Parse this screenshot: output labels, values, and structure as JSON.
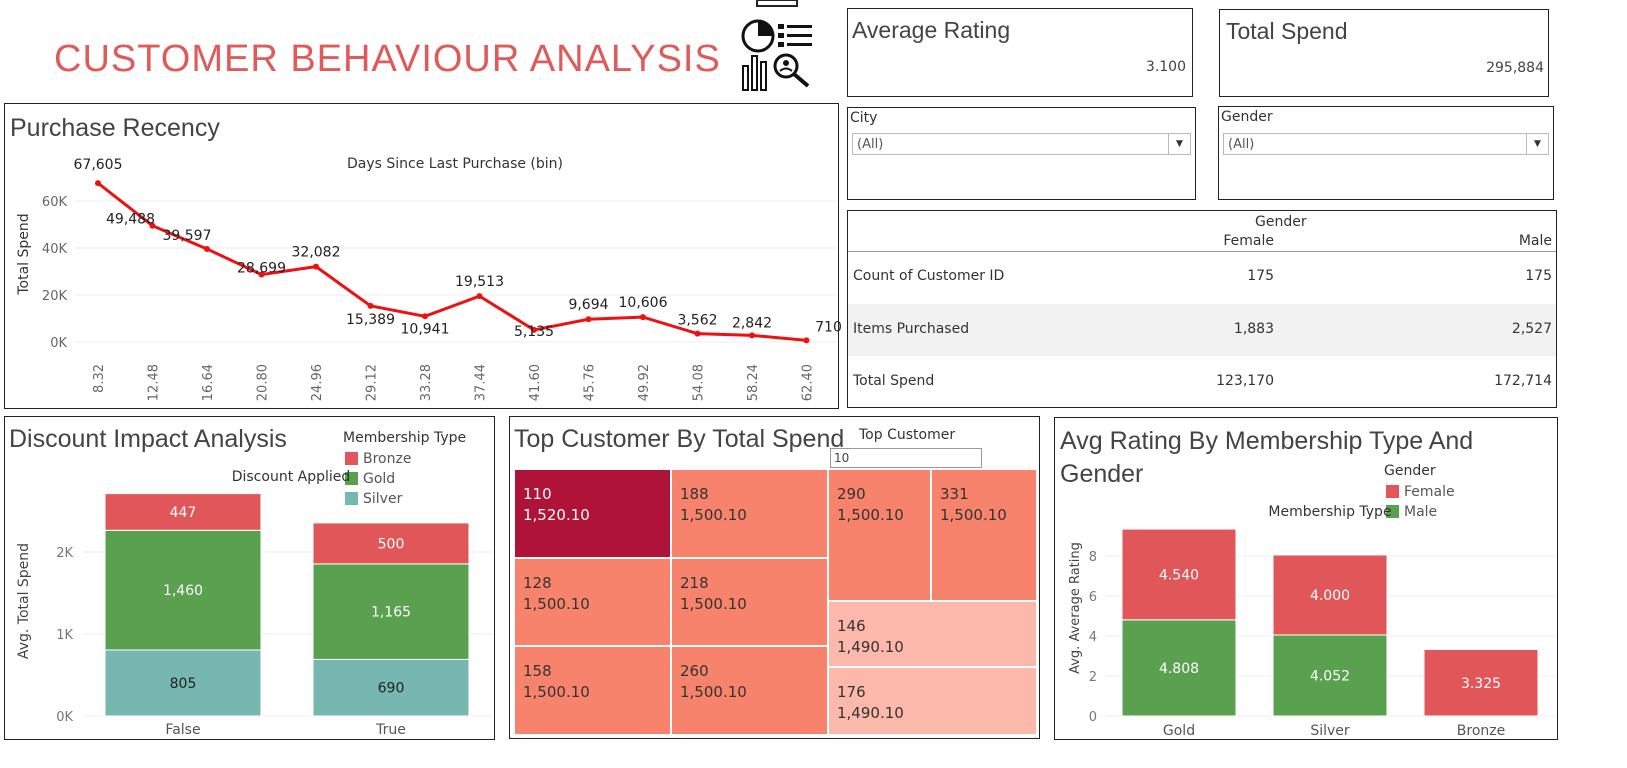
{
  "header": {
    "title": "CUSTOMER BEHAVIOUR ANALYSIS",
    "logo_icon": "analytics-report-icon",
    "title_color": "#e05a5a"
  },
  "kpis": {
    "avg_rating_label": "Average Rating",
    "avg_rating_value": "3.100",
    "total_spend_label": "Total Spend",
    "total_spend_value": "295,884"
  },
  "filters": {
    "city_label": "City",
    "city_value": "(All)",
    "gender_label": "Gender",
    "gender_value": "(All)"
  },
  "gender_table": {
    "header": "Gender",
    "columns": [
      "Female",
      "Male"
    ],
    "rows": [
      {
        "label": "Count of Customer ID",
        "values": [
          "175",
          "175"
        ]
      },
      {
        "label": "Items Purchased",
        "values": [
          "1,883",
          "2,527"
        ]
      },
      {
        "label": "Total Spend",
        "values": [
          "123,170",
          "172,714"
        ]
      }
    ]
  },
  "purchase_recency": {
    "title": "Purchase Recency",
    "chart_data": {
      "type": "line",
      "title": "Days Since Last Purchase (bin)",
      "ylabel": "Total Spend",
      "x": [
        "8.32",
        "12.48",
        "16.64",
        "20.80",
        "24.96",
        "29.12",
        "33.28",
        "37.44",
        "41.60",
        "45.76",
        "49.92",
        "54.08",
        "58.24",
        "62.40"
      ],
      "values": [
        67605,
        49488,
        39597,
        28699,
        32082,
        15389,
        10941,
        19513,
        5135,
        9694,
        10606,
        3562,
        2842,
        710
      ],
      "value_labels": [
        "67,605",
        "49,488",
        "39,597",
        "28,699",
        "32,082",
        "15,389",
        "10,941",
        "19,513",
        "5,135",
        "9,694",
        "10,606",
        "3,562",
        "2,842",
        "710"
      ],
      "yticks": [
        "0K",
        "20K",
        "40K",
        "60K"
      ],
      "ylim": [
        0,
        70000
      ],
      "color": "#ee1111"
    }
  },
  "discount": {
    "title": "Discount Impact Analysis",
    "legend_title": "Membership Type",
    "chart_data": {
      "type": "bar",
      "title": "Discount Applied",
      "ylabel": "Avg. Total Spend",
      "categories": [
        "False",
        "True"
      ],
      "series": [
        {
          "name": "Silver",
          "values": [
            805,
            690
          ],
          "labels": [
            "805",
            "690"
          ],
          "color": "#76b7b2"
        },
        {
          "name": "Gold",
          "values": [
            1460,
            1165
          ],
          "labels": [
            "1,460",
            "1,165"
          ],
          "color": "#59a14f"
        },
        {
          "name": "Bronze",
          "values": [
            447,
            500
          ],
          "labels": [
            "447",
            "500"
          ],
          "color": "#e15759"
        }
      ],
      "yticks": [
        "0K",
        "1K",
        "2K"
      ],
      "ylim": [
        0,
        2900
      ]
    },
    "legend": [
      "Bronze",
      "Gold",
      "Silver"
    ]
  },
  "top_customer": {
    "title": "Top Customer By Total Spend",
    "filter_label": "Top Customer",
    "filter_value": "10",
    "cells": [
      {
        "id": "110",
        "value": "1,520.10",
        "color": "#b01338"
      },
      {
        "id": "188",
        "value": "1,500.10",
        "color": "#f8836c"
      },
      {
        "id": "290",
        "value": "1,500.10",
        "color": "#f8836c"
      },
      {
        "id": "331",
        "value": "1,500.10",
        "color": "#f8836c"
      },
      {
        "id": "128",
        "value": "1,500.10",
        "color": "#f8836c"
      },
      {
        "id": "218",
        "value": "1,500.10",
        "color": "#f8836c"
      },
      {
        "id": "146",
        "value": "1,490.10",
        "color": "#fcb9ab"
      },
      {
        "id": "158",
        "value": "1,500.10",
        "color": "#f8836c"
      },
      {
        "id": "260",
        "value": "1,500.10",
        "color": "#f8836c"
      },
      {
        "id": "176",
        "value": "1,490.10",
        "color": "#fcb9ab"
      }
    ]
  },
  "avg_rating": {
    "title_line1": "Avg Rating By Membership Type And",
    "title_line2": "Gender",
    "legend_title": "Gender",
    "legend": [
      "Female",
      "Male"
    ],
    "chart_data": {
      "type": "bar",
      "title": "Membership Type",
      "ylabel": "Avg. Average Rating",
      "categories": [
        "Gold",
        "Silver",
        "Bronze"
      ],
      "series": [
        {
          "name": "Male",
          "values": [
            4.808,
            4.052,
            0
          ],
          "labels": [
            "4.808",
            "4.052",
            ""
          ],
          "color": "#59a14f"
        },
        {
          "name": "Female",
          "values": [
            4.54,
            4.0,
            3.325
          ],
          "labels": [
            "4.540",
            "4.000",
            "3.325"
          ],
          "color": "#e15759"
        }
      ],
      "yticks": [
        "0",
        "2",
        "4",
        "6",
        "8"
      ],
      "ylim": [
        0,
        9.6
      ]
    }
  }
}
